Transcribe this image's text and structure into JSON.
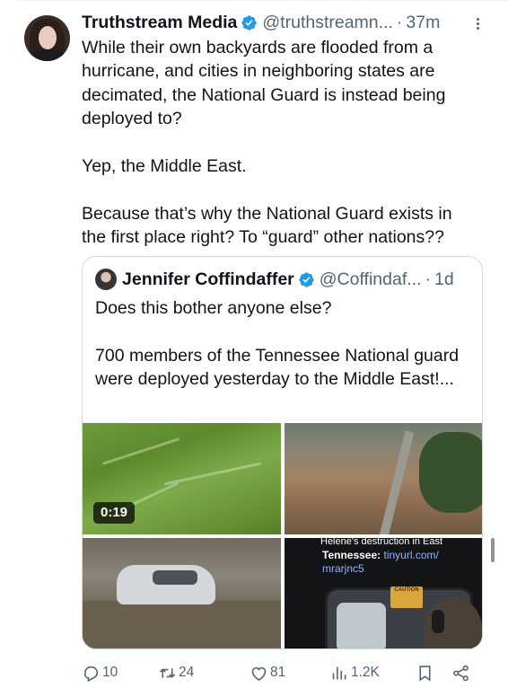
{
  "tweet": {
    "display_name": "Truthstream Media",
    "handle": "@truthstreamn...",
    "separator": "·",
    "time": "37m",
    "paragraphs": [
      "While their own backyards are flooded from a hurricane, and cities in neighboring states are decimated, the National Guard is instead being deployed to?",
      "Yep, the Middle East.",
      "Because that’s why the National Guard exists in the first place right? To “guard” other nations??"
    ],
    "icons": {
      "verified": "verified-badge-icon",
      "more": "more-options-icon"
    },
    "colors": {
      "accent": "#1d9bf0",
      "text": "#0f1419",
      "secondary": "#536471",
      "border": "#cfd9de"
    }
  },
  "quote": {
    "display_name": "Jennifer Coffindaffer",
    "handle": "@Coffindaf...",
    "separator": "·",
    "time": "1d",
    "paragraphs": [
      "Does this bother anyone else?",
      "700 members of the Tennessee National guard were deployed yesterday to the Middle East!..."
    ],
    "media": {
      "video_duration": "0:19",
      "caption_line1": "Helene's destruction in East",
      "caption_line2_bold": "Tennessee:",
      "caption_line2_url": "tinyurl.com/",
      "caption_line3": "mrarjnc5",
      "sign_text": "CAUTION"
    }
  },
  "actions": {
    "replies": "10",
    "reposts": "24",
    "likes": "81",
    "views": "1.2K",
    "icons": [
      "reply-icon",
      "repost-icon",
      "like-icon",
      "views-icon",
      "bookmark-icon",
      "share-icon"
    ]
  }
}
